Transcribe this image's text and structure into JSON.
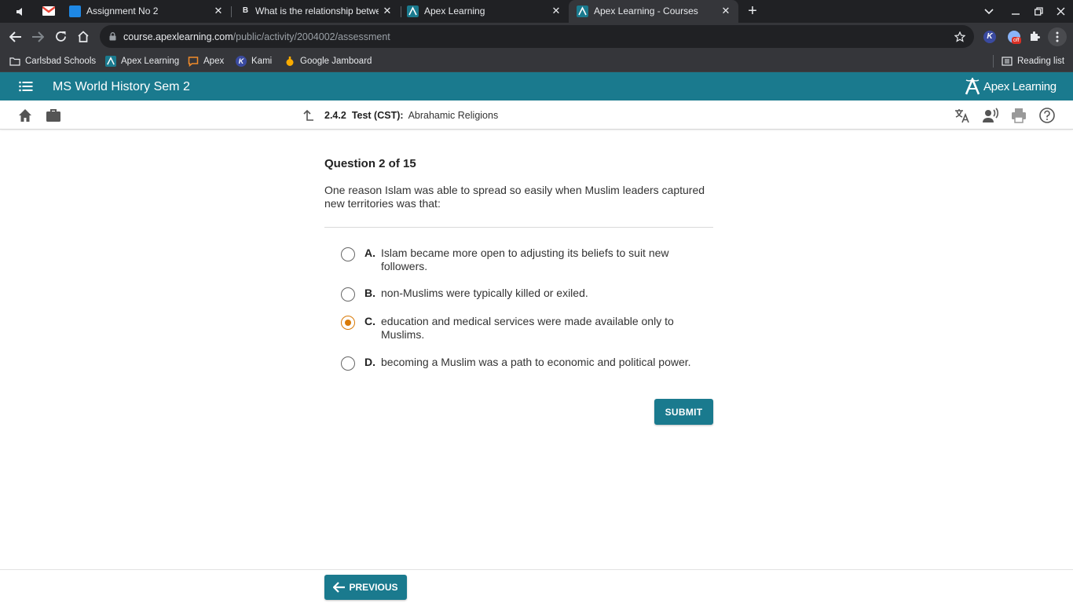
{
  "browser": {
    "tabs": [
      {
        "title": "",
        "favicon": "speaker-icon"
      },
      {
        "title": "",
        "favicon": "gmail-icon"
      },
      {
        "title": "Assignment No 2",
        "favicon": "classroom-icon"
      },
      {
        "title": "What is the relationship betwee",
        "favicon": "brainly-icon"
      },
      {
        "title": "Apex Learning",
        "favicon": "apex-icon"
      },
      {
        "title": "Apex Learning - Courses",
        "favicon": "apex-icon",
        "active": true
      }
    ],
    "url_host": "course.apexlearning.com",
    "url_path": "/public/activity/2004002/assessment",
    "bookmarks": [
      {
        "label": "Carlsbad Schools",
        "icon": "folder-icon"
      },
      {
        "label": "Apex Learning",
        "icon": "apex-icon"
      },
      {
        "label": "Apex",
        "icon": "chat-icon"
      },
      {
        "label": "Kami",
        "icon": "kami-icon"
      },
      {
        "label": "Google Jamboard",
        "icon": "jamboard-icon"
      }
    ],
    "reading_list": "Reading list",
    "extension_badge": "off"
  },
  "app": {
    "course_title": "MS World History Sem 2",
    "logo_text": "Apex Learning",
    "activity_number": "2.4.2",
    "activity_type": "Test (CST):",
    "activity_name": "Abrahamic Religions"
  },
  "question": {
    "counter": "Question 2 of 15",
    "prompt": "One reason Islam was able to spread so easily when Muslim leaders captured new territories was that:",
    "choices": [
      {
        "letter": "A.",
        "text": "Islam became more open to adjusting its beliefs to suit new followers.",
        "selected": false
      },
      {
        "letter": "B.",
        "text": "non-Muslims were typically killed or exiled.",
        "selected": false
      },
      {
        "letter": "C.",
        "text": "education and medical services were made available only to Muslims.",
        "selected": true
      },
      {
        "letter": "D.",
        "text": "becoming a Muslim was a path to economic and political power.",
        "selected": false
      }
    ],
    "submit_label": "SUBMIT"
  },
  "footer": {
    "previous_label": "PREVIOUS"
  },
  "colors": {
    "brand": "#1a7a8e",
    "selected": "#d97a07",
    "chrome_dark": "#202124",
    "chrome_toolbar": "#35363a"
  }
}
